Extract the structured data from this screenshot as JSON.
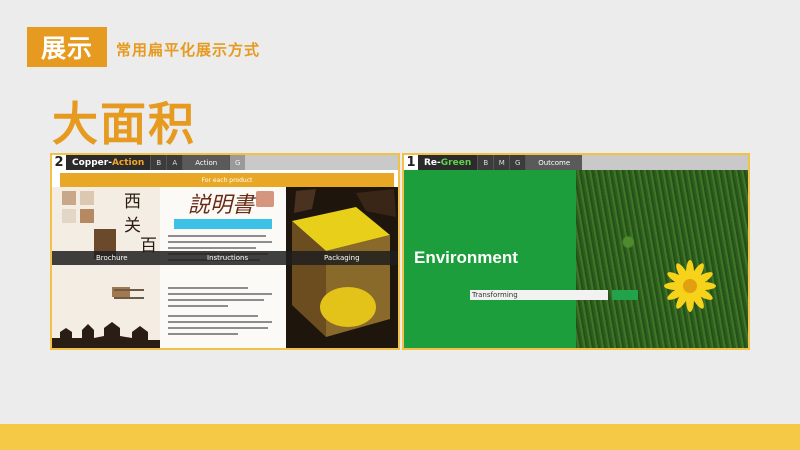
{
  "header": {
    "section_label": "展示",
    "subtitle": "常用扁平化展示方式",
    "big_title": "大面积"
  },
  "panel_left": {
    "number": "2",
    "name_part1": "Copper-",
    "name_part2": "Action",
    "tabs": [
      "B",
      "A",
      "Action",
      "G"
    ],
    "orange_bar_text": "For each product",
    "calligraphy": [
      "西",
      "关",
      "百"
    ],
    "doc_title": "説明書",
    "overlay_labels": [
      "Brochure",
      "Instructions",
      "Packaging"
    ]
  },
  "panel_right": {
    "number": "1",
    "name_part1": "Re-",
    "name_part2": "Green",
    "tabs": [
      "B",
      "M",
      "G",
      "Outcome"
    ],
    "env_title": "Environment",
    "transform_label": "Transforming"
  },
  "colors": {
    "accent_orange": "#e69a1f",
    "footer_yellow": "#f5c945",
    "panel_border": "#f2c148",
    "green": "#1c9e3c"
  }
}
